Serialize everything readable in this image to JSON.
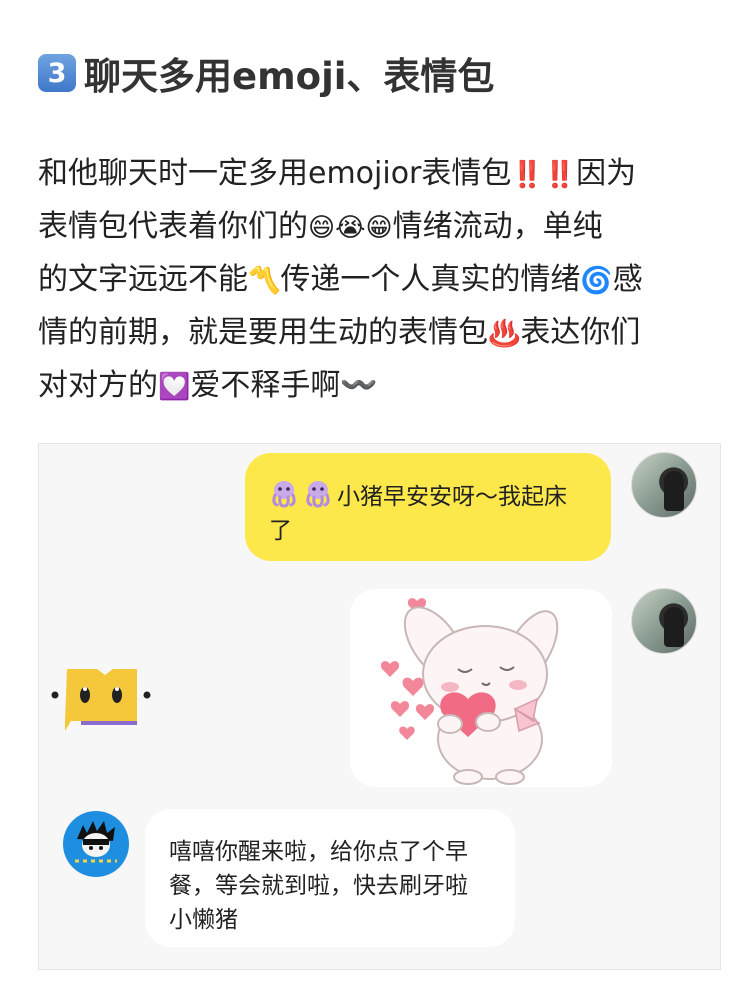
{
  "heading": {
    "badge": "3",
    "title": "聊天多用emoji、表情包"
  },
  "paragraph": {
    "lines": [
      [
        "和他聊天时一定多用emojior表情包",
        "‼️‼️",
        "因为"
      ],
      [
        "表情包代表着你们的",
        "😄😭😁",
        "情绪流动，单纯"
      ],
      [
        "的文字远远不能",
        "〽️",
        "传递一个人真实的情绪",
        "🌀",
        "感"
      ],
      [
        "情的前期，就是要用生动的表情包",
        "♨️",
        "表达你们"
      ],
      [
        "对对方的",
        "💟",
        "爱不释手啊〰️"
      ]
    ]
  },
  "chat": {
    "messages": [
      {
        "side": "right",
        "type": "text",
        "text_line1": "小猪早安安呀～我起床",
        "text_line2": "了",
        "prefix_icons": [
          "octopus-emoji",
          "octopus-emoji"
        ]
      },
      {
        "side": "right",
        "type": "sticker",
        "sticker": "bunny-holding-heart-sticker"
      },
      {
        "side": "left",
        "type": "text",
        "text_line1": "嘻嘻你醒来啦，给你点了个早",
        "text_line2": "餐，等会就到啦，快去刷牙啦",
        "text_line3": "小懒猪"
      }
    ]
  },
  "colors": {
    "yellow_bubble": "#fde84b",
    "chat_bg": "#f7f7f7",
    "avatar_blue": "#1e8fe0"
  }
}
